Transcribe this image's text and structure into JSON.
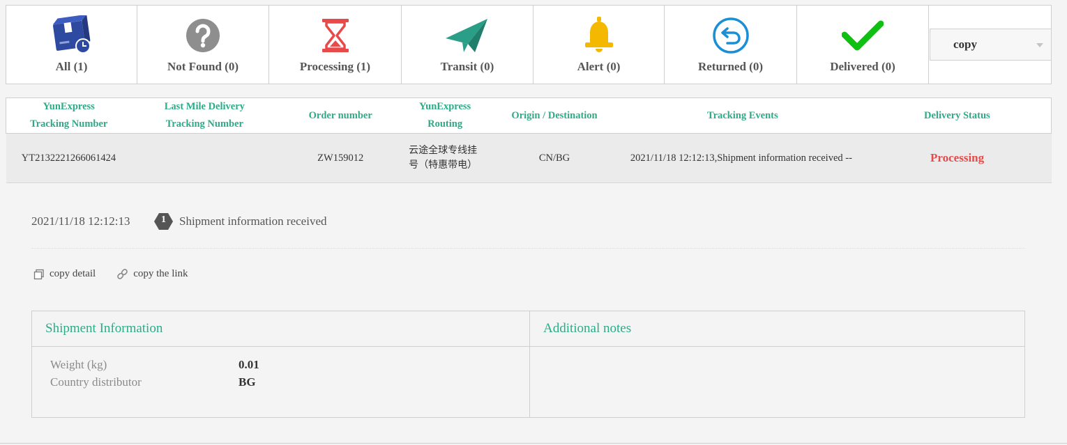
{
  "status_tabs": [
    {
      "label": "All (1)",
      "icon": "package-icon",
      "color": "#2e49a0"
    },
    {
      "label": "Not Found (0)",
      "icon": "question-icon",
      "color": "#8e8e8e"
    },
    {
      "label": "Processing (1)",
      "icon": "hourglass-icon",
      "color": "#e84a4a"
    },
    {
      "label": "Transit (0)",
      "icon": "paper-plane-icon",
      "color": "#2a9e86"
    },
    {
      "label": "Alert (0)",
      "icon": "bell-icon",
      "color": "#f5b800"
    },
    {
      "label": "Returned (0)",
      "icon": "return-icon",
      "color": "#1a8fd6"
    },
    {
      "label": "Delivered (0)",
      "icon": "check-icon",
      "color": "#0fbf12"
    }
  ],
  "copy_select": {
    "value": "copy"
  },
  "table": {
    "headers": {
      "tracking_number": [
        "YunExpress",
        "Tracking Number"
      ],
      "last_mile": [
        "Last Mile Delivery",
        "Tracking Number"
      ],
      "order_number": "Order number",
      "routing": [
        "YunExpress",
        "Routing"
      ],
      "origin_destination": "Origin / Destination",
      "tracking_events": "Tracking Events",
      "delivery_status": "Delivery Status"
    },
    "rows": [
      {
        "tracking_number": "YT2132221266061424",
        "last_mile": "",
        "order_number": "ZW159012",
        "routing_line1": "云途全球专线挂",
        "routing_line2": "号（特惠带电）",
        "origin_destination": "CN/BG",
        "tracking_events": "2021/11/18 12:12:13,Shipment information received --",
        "delivery_status": "Processing"
      }
    ]
  },
  "event": {
    "time": "2021/11/18 12:12:13",
    "step": "1",
    "description": "Shipment information received"
  },
  "copy_links": {
    "copy_detail": "copy detail",
    "copy_link": "copy the link"
  },
  "shipment_info": {
    "title": "Shipment Information",
    "rows": [
      {
        "key": "Weight (kg)",
        "value": "0.01"
      },
      {
        "key": "Country distributor",
        "value": "BG"
      }
    ]
  },
  "additional_notes": {
    "title": "Additional notes"
  },
  "colors": {
    "accent": "#2dab87",
    "status_processing": "#e84a4a"
  }
}
